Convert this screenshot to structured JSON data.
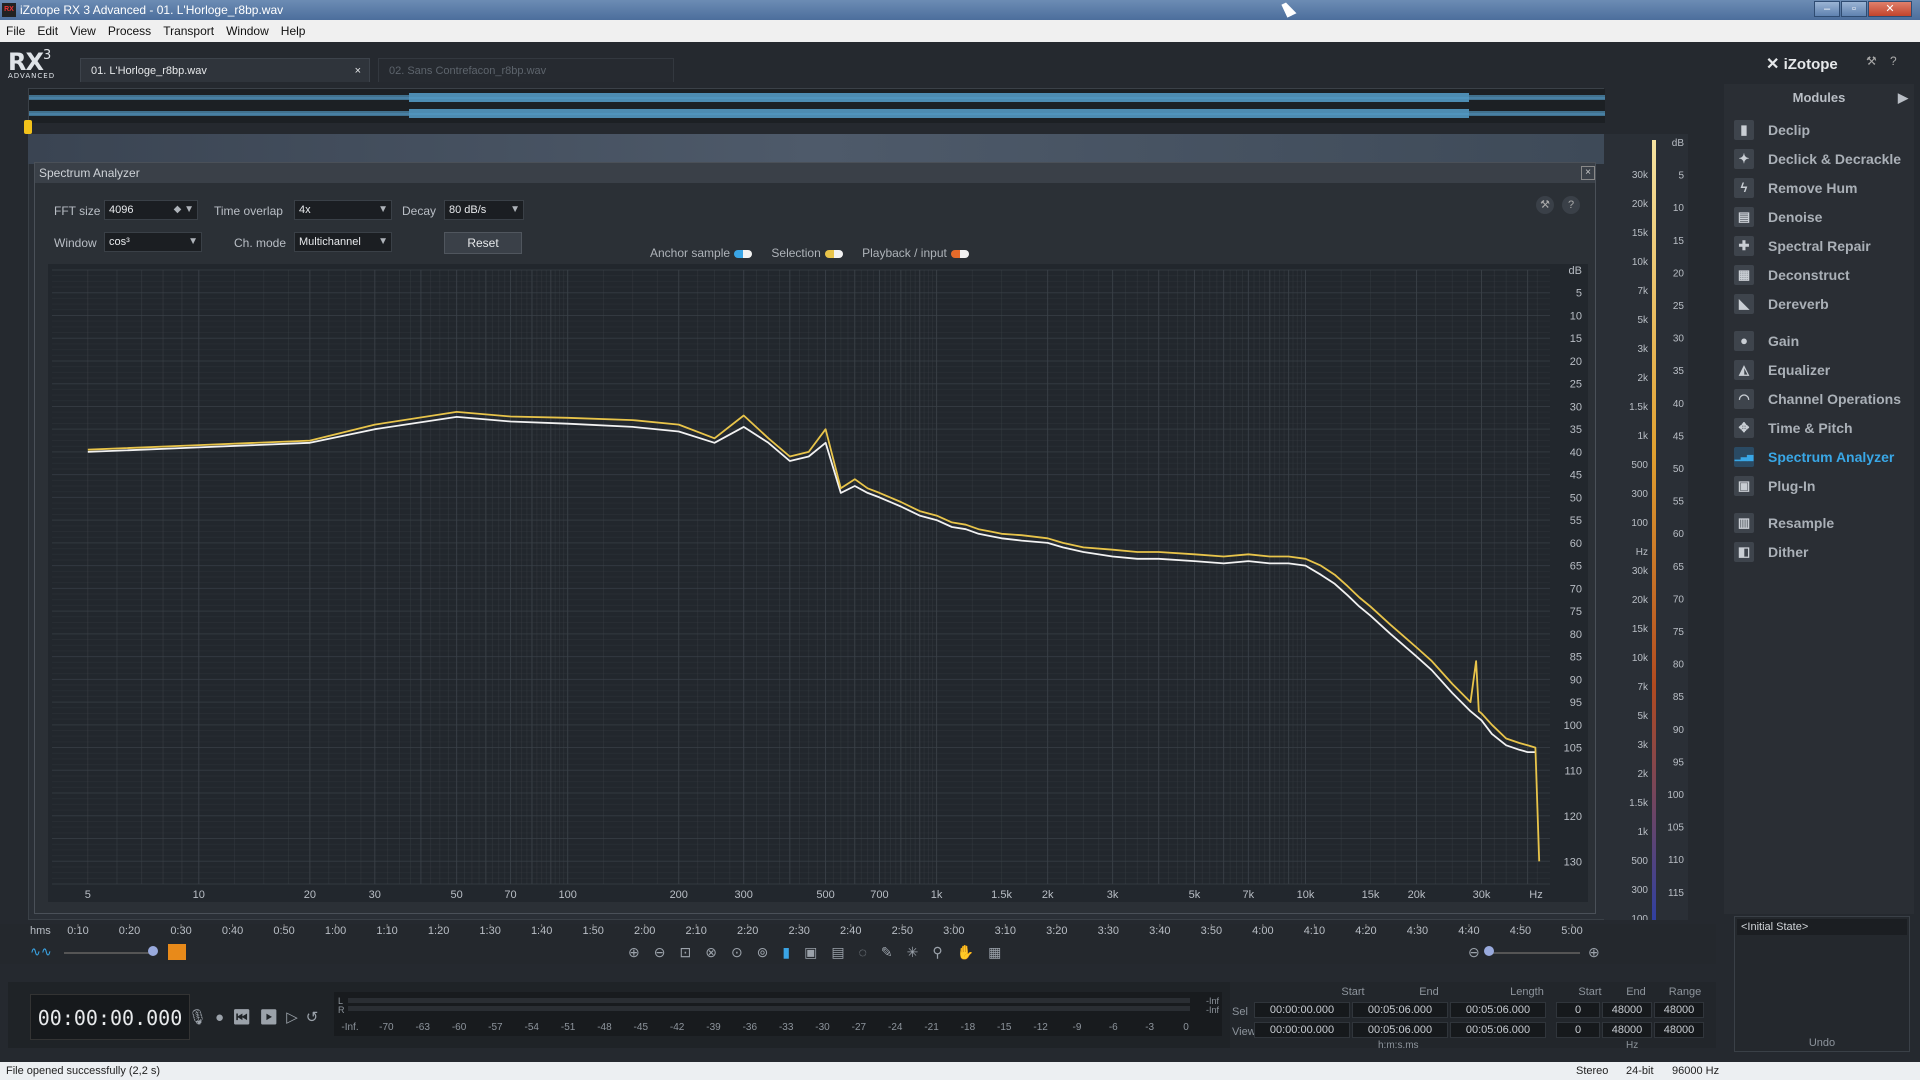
{
  "window": {
    "title": "iZotope RX 3 Advanced - 01. L'Horloge_r8bp.wav",
    "app_icon": "RX",
    "buttons": [
      "–",
      "▫",
      "✕"
    ]
  },
  "menu": [
    "File",
    "Edit",
    "View",
    "Process",
    "Transport",
    "Window",
    "Help"
  ],
  "logo": {
    "text": "RX",
    "version": "3",
    "sub": "ADVANCED"
  },
  "tabs": [
    {
      "label": "01. L'Horloge_r8bp.wav",
      "close": "×"
    },
    {
      "label": "02. Sans Contrefacon_r8bp.wav"
    }
  ],
  "spectrum_analyzer": {
    "title": "Spectrum Analyzer",
    "fft_label": "FFT size",
    "fft_value": "4096",
    "overlap_label": "Time overlap",
    "overlap_value": "4x",
    "decay_label": "Decay",
    "decay_value": "80 dB/s",
    "window_label": "Window",
    "window_value": "cos³",
    "chmode_label": "Ch. mode",
    "chmode_value": "Multichannel",
    "reset": "Reset",
    "legend": {
      "anchor": "Anchor sample",
      "selection": "Selection",
      "playback": "Playback / input",
      "lr": "L R"
    },
    "colors": {
      "selection": "#e8c44a",
      "playback": "#e56a2a",
      "anchor": "#3aa5e6",
      "curve_white": "#f2f2f2"
    }
  },
  "chart_data": {
    "type": "line",
    "xscale": "log",
    "ylabel": "dB",
    "x_ticks": [
      "5",
      "10",
      "20",
      "30",
      "50",
      "70",
      "100",
      "200",
      "300",
      "500",
      "700",
      "1k",
      "1.5k",
      "2k",
      "3k",
      "5k",
      "7k",
      "10k",
      "15k",
      "20k",
      "30k",
      "Hz"
    ],
    "y_ticks": [
      "dB",
      "5",
      "10",
      "15",
      "20",
      "25",
      "30",
      "35",
      "40",
      "45",
      "50",
      "55",
      "60",
      "65",
      "70",
      "75",
      "80",
      "85",
      "90",
      "95",
      "100",
      "105",
      "110",
      "120",
      "130"
    ],
    "ylim": [
      0,
      135
    ],
    "series": [
      {
        "color": "#e8c44a",
        "x": [
          5,
          10,
          20,
          30,
          50,
          70,
          100,
          150,
          200,
          250,
          300,
          350,
          400,
          450,
          500,
          550,
          600,
          650,
          700,
          800,
          900,
          1000,
          1100,
          1200,
          1300,
          1400,
          1500,
          1700,
          2000,
          2200,
          2500,
          3000,
          3500,
          4000,
          5000,
          6000,
          7000,
          8000,
          9000,
          10000,
          11000,
          12000,
          13000,
          14000,
          15000,
          17000,
          20000,
          22000,
          25000,
          28000,
          29000,
          29500,
          30000,
          32000,
          35000,
          38000,
          40000,
          42000,
          43000
        ],
        "y": [
          39.5,
          38.5,
          37.5,
          34,
          31.2,
          32.2,
          32.5,
          33,
          34,
          37,
          32,
          37,
          41,
          40,
          35,
          48,
          46,
          48,
          49,
          51,
          53,
          54,
          55.5,
          56,
          57,
          57.5,
          58,
          58.3,
          59,
          60,
          61,
          61.5,
          62,
          62,
          62.5,
          63,
          62.5,
          63,
          63,
          63.5,
          65,
          67,
          69.5,
          72,
          74,
          78,
          83,
          86,
          91,
          95,
          86,
          97,
          97.5,
          100,
          103,
          104,
          104.5,
          105,
          130
        ]
      },
      {
        "color": "#f2f2f2",
        "x": [
          5,
          10,
          20,
          30,
          50,
          70,
          100,
          150,
          200,
          250,
          300,
          350,
          400,
          450,
          500,
          550,
          600,
          650,
          700,
          800,
          900,
          1000,
          1100,
          1200,
          1300,
          1400,
          1500,
          1700,
          2000,
          2200,
          2500,
          3000,
          3500,
          4000,
          5000,
          6000,
          7000,
          8000,
          9000,
          10000,
          11000,
          12000,
          13000,
          14000,
          15000,
          17000,
          20000,
          22000,
          25000,
          28000,
          30000,
          32000,
          35000,
          38000,
          40000,
          42000
        ],
        "y": [
          40,
          39,
          38,
          35,
          32.3,
          33.3,
          33.8,
          34.5,
          35.5,
          38,
          34.5,
          38,
          42,
          41,
          38,
          49,
          47.5,
          49,
          50,
          52,
          54,
          55,
          56.5,
          57,
          58,
          58.5,
          59,
          59.5,
          60,
          61,
          62,
          63,
          63.5,
          63.5,
          64,
          64.5,
          64,
          64.5,
          64.5,
          65,
          67,
          69,
          71.5,
          74,
          76,
          80,
          85,
          88,
          93,
          97,
          99,
          102,
          104.5,
          105.5,
          106,
          106
        ]
      }
    ]
  },
  "time_ruler": {
    "unit": "hms",
    "labels": [
      "0:10",
      "0:20",
      "0:30",
      "0:40",
      "0:50",
      "1:00",
      "1:10",
      "1:20",
      "1:30",
      "1:40",
      "1:50",
      "2:00",
      "2:10",
      "2:20",
      "2:30",
      "2:40",
      "2:50",
      "3:00",
      "3:10",
      "3:20",
      "3:30",
      "3:40",
      "3:50",
      "4:00",
      "4:10",
      "4:20",
      "4:30",
      "4:40",
      "4:50",
      "5:00"
    ]
  },
  "right_ruler": {
    "db": [
      "dB",
      "5",
      "10",
      "15",
      "20",
      "25",
      "30",
      "35",
      "40",
      "45",
      "50",
      "55",
      "60",
      "65",
      "70",
      "75",
      "80",
      "85",
      "90",
      "95",
      "100",
      "105",
      "110",
      "115"
    ],
    "hz_upper": [
      "30k",
      "20k",
      "15k",
      "10k",
      "7k",
      "5k",
      "3k",
      "2k",
      "1.5k",
      "1k",
      "500",
      "300",
      "100",
      "Hz"
    ],
    "hz_lower": [
      "30k",
      "20k",
      "15k",
      "10k",
      "7k",
      "5k",
      "3k",
      "2k",
      "1.5k",
      "1k",
      "500",
      "300",
      "100"
    ]
  },
  "brand": "iZotope",
  "modules": {
    "header": "Modules",
    "groups": [
      [
        {
          "label": "Declip",
          "icon": "declip-icon",
          "glyph": "▮"
        },
        {
          "label": "Declick & Decrackle",
          "icon": "declick-icon",
          "glyph": "✦"
        },
        {
          "label": "Remove Hum",
          "icon": "hum-icon",
          "glyph": "ϟ"
        },
        {
          "label": "Denoise",
          "icon": "denoise-icon",
          "glyph": "▤"
        },
        {
          "label": "Spectral Repair",
          "icon": "spectral-repair-icon",
          "glyph": "✚"
        },
        {
          "label": "Deconstruct",
          "icon": "deconstruct-icon",
          "glyph": "▦"
        },
        {
          "label": "Dereverb",
          "icon": "dereverb-icon",
          "glyph": "◣"
        }
      ],
      [
        {
          "label": "Gain",
          "icon": "gain-icon",
          "glyph": "●"
        },
        {
          "label": "Equalizer",
          "icon": "equalizer-icon",
          "glyph": "◭"
        },
        {
          "label": "Channel Operations",
          "icon": "channel-ops-icon",
          "glyph": "◠"
        },
        {
          "label": "Time & Pitch",
          "icon": "time-pitch-icon",
          "glyph": "✥"
        },
        {
          "label": "Spectrum Analyzer",
          "icon": "spectrum-analyzer-icon",
          "glyph": "▁▃▅",
          "active": true
        },
        {
          "label": "Plug-In",
          "icon": "plugin-icon",
          "glyph": "▣"
        }
      ],
      [
        {
          "label": "Resample",
          "icon": "resample-icon",
          "glyph": "▥"
        },
        {
          "label": "Dither",
          "icon": "dither-icon",
          "glyph": "◧"
        }
      ]
    ]
  },
  "history": {
    "item": "<Initial State>",
    "footer": "Undo"
  },
  "transport": {
    "time": "00:00:00.000",
    "meter_scale": [
      "-Inf.",
      "-70",
      "-63",
      "-60",
      "-57",
      "-54",
      "-51",
      "-48",
      "-45",
      "-42",
      "-39",
      "-36",
      "-33",
      "-30",
      "-27",
      "-24",
      "-21",
      "-18",
      "-15",
      "-12",
      "-9",
      "-6",
      "-3",
      "0"
    ],
    "meter_l": "L",
    "meter_r": "R",
    "peak_l": "-Inf",
    "peak_r": "-Inf"
  },
  "selection_info": {
    "headers": [
      "Start",
      "End",
      "Length"
    ],
    "freq_headers": [
      "Start",
      "End",
      "Range"
    ],
    "rows": [
      {
        "label": "Sel",
        "start": "00:00:00.000",
        "end": "00:05:06.000",
        "length": "00:05:06.000",
        "fstart": "0",
        "fend": "48000",
        "frange": "48000"
      },
      {
        "label": "View",
        "start": "00:00:00.000",
        "end": "00:05:06.000",
        "length": "00:05:06.000",
        "fstart": "0",
        "fend": "48000",
        "frange": "48000"
      }
    ],
    "time_unit": "h:m:s.ms",
    "freq_unit": "Hz"
  },
  "status": {
    "message": "File opened successfully (2,2 s)",
    "channels": "Stereo",
    "bits": "24-bit",
    "rate": "96000 Hz"
  }
}
